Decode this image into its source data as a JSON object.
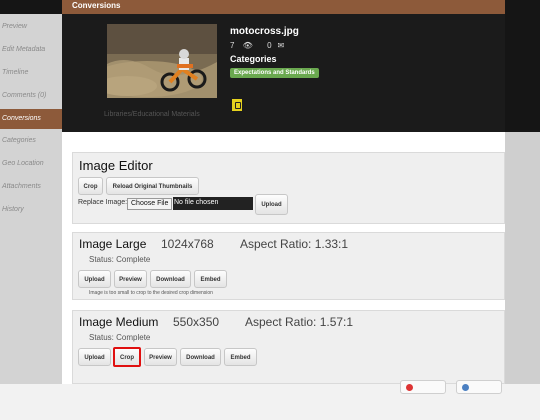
{
  "header": {
    "title": "Conversions"
  },
  "sidebar": {
    "items": [
      {
        "label": "Preview"
      },
      {
        "label": "Edit Metadata"
      },
      {
        "label": "Timeline"
      },
      {
        "label": "Comments (0)"
      },
      {
        "label": "Conversions",
        "active": true
      },
      {
        "label": "Categories"
      },
      {
        "label": "Geo Location"
      },
      {
        "label": "Attachments"
      },
      {
        "label": "History"
      }
    ]
  },
  "media": {
    "filename": "motocross.jpg",
    "views": "7",
    "comments": "0",
    "categories_title": "Categories",
    "category_tag": "Expectations and Standards",
    "folder": "Libraries/Educational Materials"
  },
  "editor": {
    "title": "Image Editor",
    "crop_label": "Crop",
    "reload_label": "Reload Original Thumbnails",
    "replace_label": "Replace Image:",
    "choose_file_label": "Choose File",
    "no_file_text": "No file chosen",
    "upload_label": "Upload"
  },
  "large": {
    "title": "Image Large",
    "dims": "1024x768",
    "aspect": "Aspect Ratio: 1.33:1",
    "status": "Status: Complete",
    "buttons": [
      "Upload",
      "Preview",
      "Download",
      "Embed"
    ],
    "note": "Image is too small to crop to the desired crop dimension"
  },
  "medium": {
    "title": "Image Medium",
    "dims": "550x350",
    "aspect": "Aspect Ratio: 1.57:1",
    "status": "Status: Complete",
    "buttons": [
      "Upload",
      "Crop",
      "Preview",
      "Download",
      "Embed"
    ]
  },
  "colors": {
    "accent": "#8d5a3a",
    "tag": "#6aa84f",
    "highlight": "#e01010"
  }
}
